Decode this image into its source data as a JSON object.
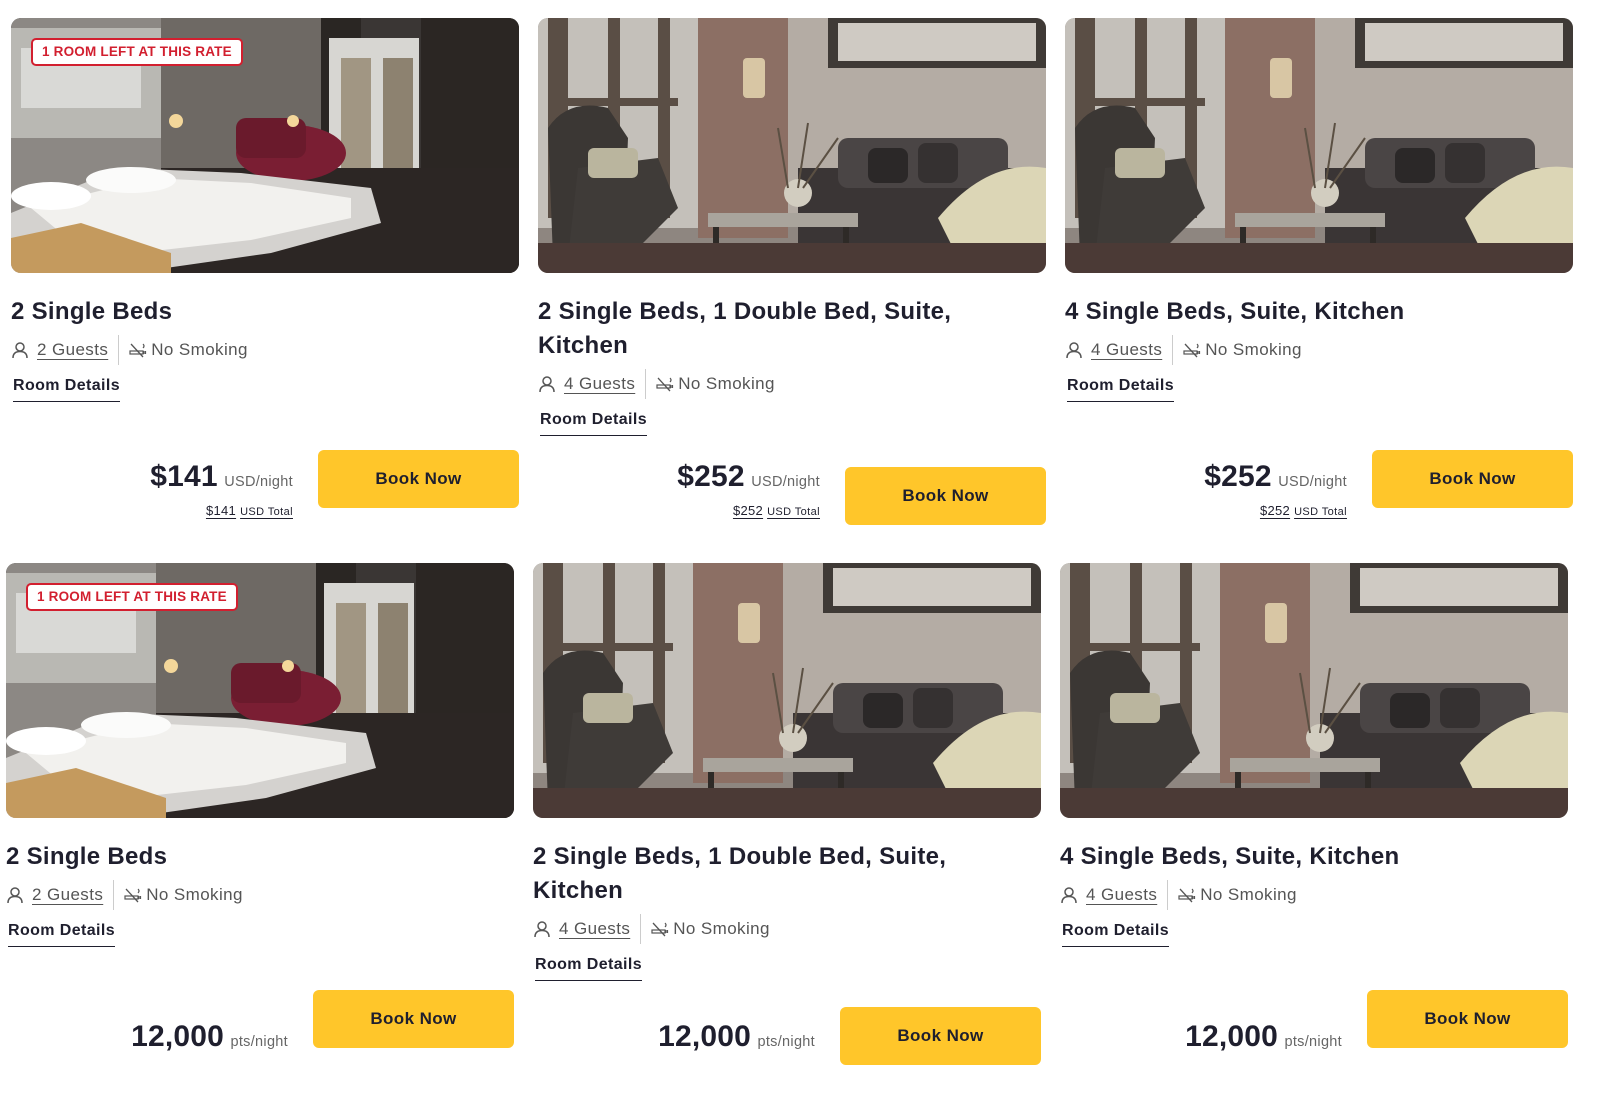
{
  "badge_text": "1 ROOM LEFT AT THIS RATE",
  "cards": [
    {
      "title": "2 Single Beds",
      "guests": "2 Guests",
      "smoking": "No Smoking",
      "details": "Room Details",
      "badge": "1 ROOM LEFT AT THIS RATE",
      "price": "$141",
      "price_unit": "USD/night",
      "total": "$141",
      "total_unit": "USD Total",
      "book": "Book Now",
      "photo": "bedroom"
    },
    {
      "title": "2 Single Beds, 1 Double Bed, Suite, Kitchen",
      "guests": "4 Guests",
      "smoking": "No Smoking",
      "details": "Room Details",
      "price": "$252",
      "price_unit": "USD/night",
      "total": "$252",
      "total_unit": "USD Total",
      "book": "Book Now",
      "photo": "living-room"
    },
    {
      "title": "4 Single Beds, Suite, Kitchen",
      "guests": "4 Guests",
      "smoking": "No Smoking",
      "details": "Room Details",
      "price": "$252",
      "price_unit": "USD/night",
      "total": "$252",
      "total_unit": "USD Total",
      "book": "Book Now",
      "photo": "living-room"
    },
    {
      "title": "2 Single Beds",
      "guests": "2 Guests",
      "smoking": "No Smoking",
      "details": "Room Details",
      "badge": "1 ROOM LEFT AT THIS RATE",
      "price": "12,000",
      "price_unit": "pts/night",
      "book": "Book Now",
      "photo": "bedroom"
    },
    {
      "title": "2 Single Beds, 1 Double Bed, Suite, Kitchen",
      "guests": "4 Guests",
      "smoking": "No Smoking",
      "details": "Room Details",
      "price": "12,000",
      "price_unit": "pts/night",
      "book": "Book Now",
      "photo": "living-room"
    },
    {
      "title": "4 Single Beds, Suite, Kitchen",
      "guests": "4 Guests",
      "smoking": "No Smoking",
      "details": "Room Details",
      "price": "12,000",
      "price_unit": "pts/night",
      "book": "Book Now",
      "photo": "living-room"
    }
  ],
  "colors": {
    "accent": "#ffc62a",
    "badge": "#d21f2f",
    "text": "#1f1f2e"
  },
  "icons": {
    "guests": "person-icon",
    "smoking": "no-smoking-icon"
  }
}
